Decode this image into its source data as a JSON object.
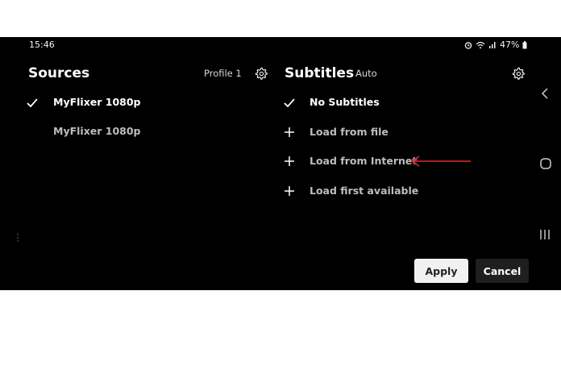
{
  "status_bar": {
    "time": "15:46",
    "battery": "47%"
  },
  "sources": {
    "title": "Sources",
    "profile": "Profile 1",
    "items": [
      {
        "label": "MyFlixer 1080p",
        "selected": true
      },
      {
        "label": "MyFlixer 1080p",
        "selected": false
      }
    ]
  },
  "subtitles": {
    "title": "Subtitles",
    "mode": "Auto",
    "items": [
      {
        "label": "No Subtitles",
        "icon": "check-icon"
      },
      {
        "label": "Load from file",
        "icon": "plus-icon"
      },
      {
        "label": "Load from Internet",
        "icon": "plus-icon"
      },
      {
        "label": "Load first available",
        "icon": "plus-icon"
      }
    ]
  },
  "buttons": {
    "apply": "Apply",
    "cancel": "Cancel"
  },
  "colors": {
    "background": "#000000",
    "annotation_arrow": "#c0262d",
    "apply_bg": "#f1f1f1",
    "cancel_bg": "#1f1f1f"
  }
}
